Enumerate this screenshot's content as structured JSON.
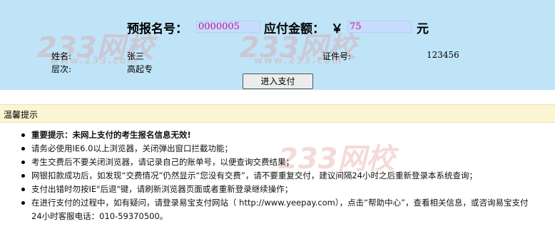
{
  "header": {
    "reg_no_label": "预报名号：",
    "reg_no_value": "0000005",
    "amount_label": "应付金额：",
    "currency_symbol": "￥",
    "amount_value": "75",
    "amount_unit": "元"
  },
  "info": {
    "name_label": "姓名:",
    "name_value": "张三",
    "level_label": "层次:",
    "level_value": "高起专",
    "id_label": "证件号:",
    "id_value": "123456"
  },
  "pay_button_label": "进入支付",
  "watermark": {
    "brand": "233网校",
    "url": "www.233.com"
  },
  "tips": {
    "title": "温馨提示",
    "items": [
      {
        "text": "重要提示：未网上支付的考生报名信息无效!"
      },
      {
        "text": "请务必使用IE6.0以上浏览器，关闭弹出窗口拦截功能；"
      },
      {
        "text": "考生交费后不要关闭浏览器，请记录自己的账单号，以便查询交费结果；"
      },
      {
        "text": "网银扣款成功后，如发现“交费情况”仍然显示“您没有交费”，请不要重复交付，建议间隔24小时之后重新登录本系统查询；"
      },
      {
        "text": "支付出错时勿按IE\"后退\"键，请刷新浏览器页面或者重新登录继续操作；"
      },
      {
        "text": "在进行支付的过程中，如有疑问，请登录易宝支付网站（  http://www.yeepay.com），点击“帮助中心”，查看相关信息，或咨询易宝支付"
      },
      {
        "text": "24小时客服电话：010-59370500。"
      }
    ]
  },
  "colors": {
    "panel_bg": "#bfe4f7",
    "field_bg": "#c7dcff",
    "field_text": "#c0148a",
    "tips_bg": "#fbf5d3",
    "warning_red": "#c00000"
  }
}
